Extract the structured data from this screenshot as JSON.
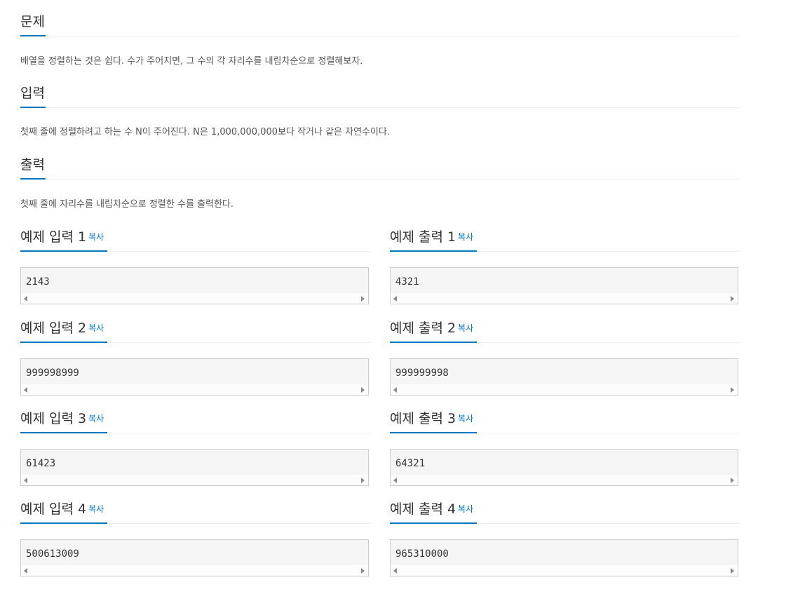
{
  "sections": {
    "problem": {
      "title": "문제",
      "text": "배열을 정렬하는 것은 쉽다. 수가 주어지면, 그 수의 각 자리수를 내림차순으로 정렬해보자."
    },
    "input": {
      "title": "입력",
      "text": "첫째 줄에 정렬하려고 하는 수 N이 주어진다. N은 1,000,000,000보다 작거나 같은 자연수이다."
    },
    "output": {
      "title": "출력",
      "text": "첫째 줄에 자리수를 내림차순으로 정렬한 수를 출력한다."
    }
  },
  "copy_label": "복사",
  "samples": [
    {
      "input_title": "예제 입력 1",
      "input_value": "2143",
      "output_title": "예제 출력 1",
      "output_value": "4321"
    },
    {
      "input_title": "예제 입력 2",
      "input_value": "999998999",
      "output_title": "예제 출력 2",
      "output_value": "999999998"
    },
    {
      "input_title": "예제 입력 3",
      "input_value": "61423",
      "output_title": "예제 출력 3",
      "output_value": "64321"
    },
    {
      "input_title": "예제 입력 4",
      "input_value": "500613009",
      "output_title": "예제 출력 4",
      "output_value": "965310000"
    }
  ],
  "colors": {
    "accent": "#0076c0",
    "code_bg": "#f5f5f5",
    "code_border": "#cccccc"
  }
}
